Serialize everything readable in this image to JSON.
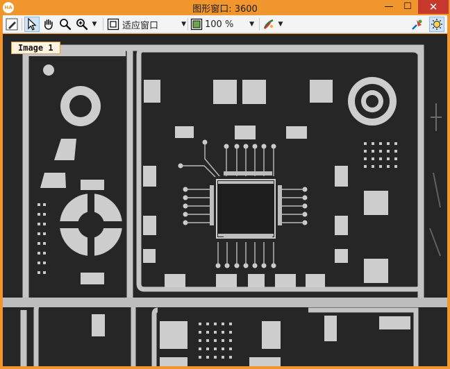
{
  "window": {
    "app_icon_text": "HA",
    "title": "图形窗口: 3600",
    "min_glyph": "—",
    "max_glyph": "☐",
    "close_glyph": "✕"
  },
  "toolbar": {
    "fit_label": "适应窗口",
    "zoom_label": "100 %",
    "dropdown_glyph": "▼"
  },
  "canvas": {
    "image_label": "Image 1",
    "background_color": "#262626",
    "pad_color": "#cdcdcd"
  },
  "colors": {
    "frame": "#f0962d",
    "close": "#c7392c",
    "selected_tool": "#cfe3f7"
  }
}
